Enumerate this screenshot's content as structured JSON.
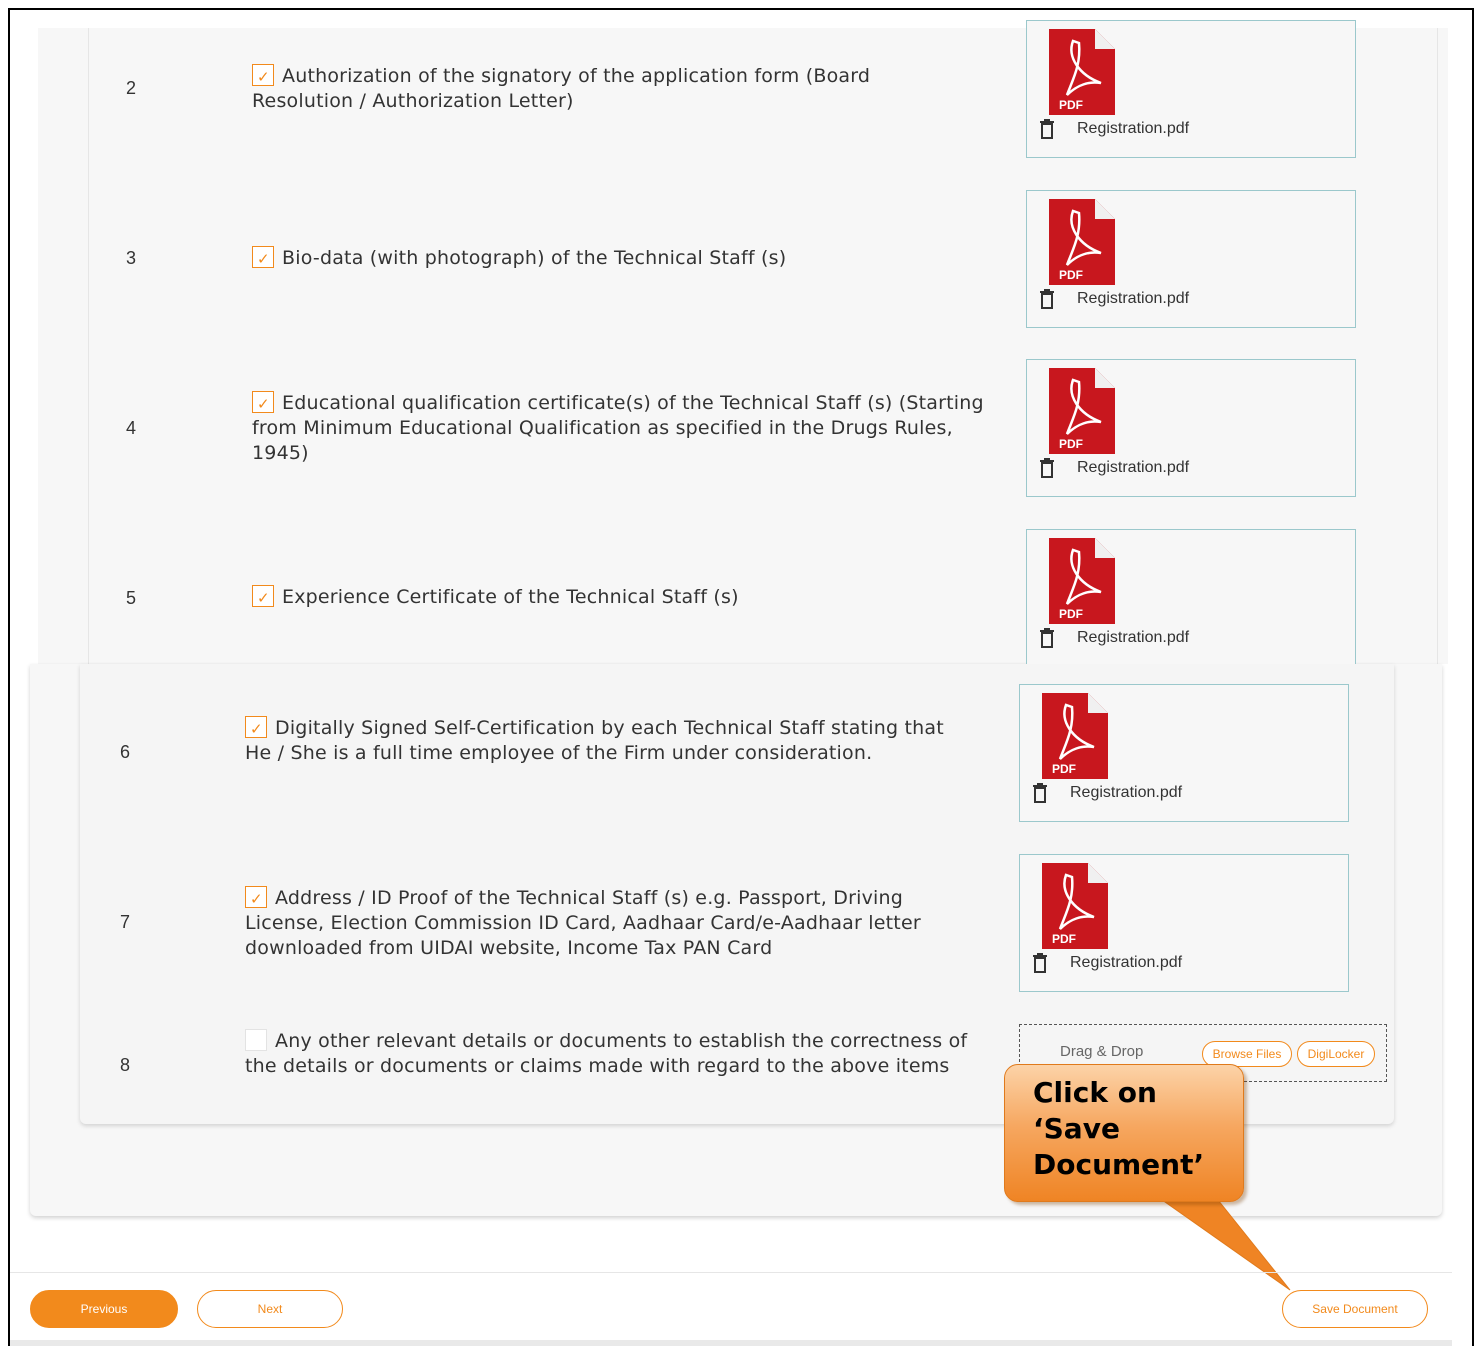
{
  "documents": [
    {
      "number": "2",
      "checked": true,
      "text": "Authorization of the signatory of the application form (Board Resolution / Authorization Letter)",
      "file_name": "Registration.pdf"
    },
    {
      "number": "3",
      "checked": true,
      "text": "Bio-data (with photograph) of the Technical Staff (s)",
      "file_name": "Registration.pdf"
    },
    {
      "number": "4",
      "checked": true,
      "text": "Educational qualification certificate(s) of the Technical Staff (s) (Starting from Minimum Educational Qualification as specified in the Drugs Rules, 1945)",
      "file_name": "Registration.pdf"
    },
    {
      "number": "5",
      "checked": true,
      "text": "Experience Certificate of the Technical Staff (s)",
      "file_name": "Registration.pdf"
    },
    {
      "number": "6",
      "checked": true,
      "text": "Digitally Signed Self-Certification by each Technical Staff stating that He / She is a full time employee of the Firm under consideration.",
      "file_name": "Registration.pdf"
    },
    {
      "number": "7",
      "checked": true,
      "text": "Address / ID Proof of the Technical Staff (s) e.g. Passport, Driving License, Election Commission ID Card, Aadhaar Card/e-Aadhaar letter downloaded from UIDAI website, Income Tax PAN Card",
      "file_name": "Registration.pdf"
    },
    {
      "number": "8",
      "checked": false,
      "text": "Any other relevant details or documents to establish the correctness of the details or documents or claims made with regard to the above items"
    }
  ],
  "upload": {
    "drop_label": "Drag & Drop",
    "browse_label": "Browse Files",
    "digilocker_label": "DigiLocker"
  },
  "pdf_badge": "PDF",
  "icons": {
    "file": "pdf-file-icon",
    "delete": "trash-icon"
  },
  "callout": {
    "text": "Click on ‘Save Document’"
  },
  "footer": {
    "previous_label": "Previous",
    "next_label": "Next",
    "save_label": "Save Document"
  },
  "colors": {
    "accent": "#f28a1c",
    "file_border": "#9bc8cc",
    "pdf_red": "#c8171e"
  }
}
